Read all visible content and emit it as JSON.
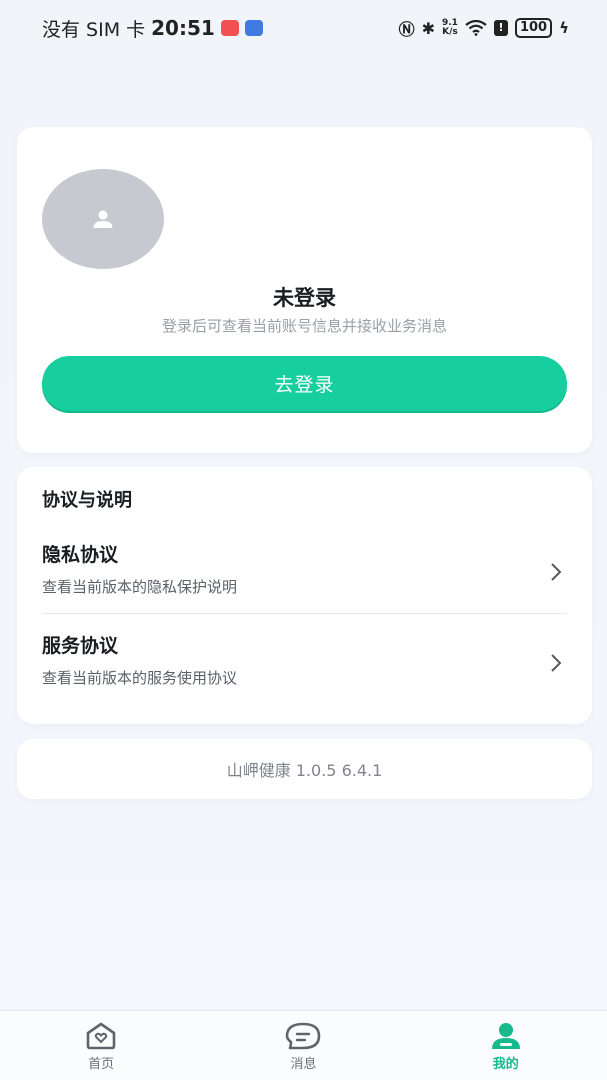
{
  "status_bar": {
    "carrier": "没有 SIM 卡",
    "time": "20:51",
    "net_speed_value": "9.1",
    "net_speed_unit": "K/s",
    "battery": "100"
  },
  "profile": {
    "title": "未登录",
    "subtitle": "登录后可查看当前账号信息并接收业务消息",
    "login_button": "去登录",
    "accent_color": "#17cf9e"
  },
  "agreements": {
    "section_title": "协议与说明",
    "items": [
      {
        "title": "隐私协议",
        "desc": "查看当前版本的隐私保护说明"
      },
      {
        "title": "服务协议",
        "desc": "查看当前版本的服务使用协议"
      }
    ]
  },
  "version": {
    "text": "山岬健康 1.0.5 6.4.1"
  },
  "tabbar": {
    "tabs": [
      {
        "label": "首页",
        "icon": "home-heart-icon",
        "active": false
      },
      {
        "label": "消息",
        "icon": "message-bubble-icon",
        "active": false
      },
      {
        "label": "我的",
        "icon": "user-profile-icon",
        "active": true
      }
    ],
    "active_color": "#17b98d"
  }
}
